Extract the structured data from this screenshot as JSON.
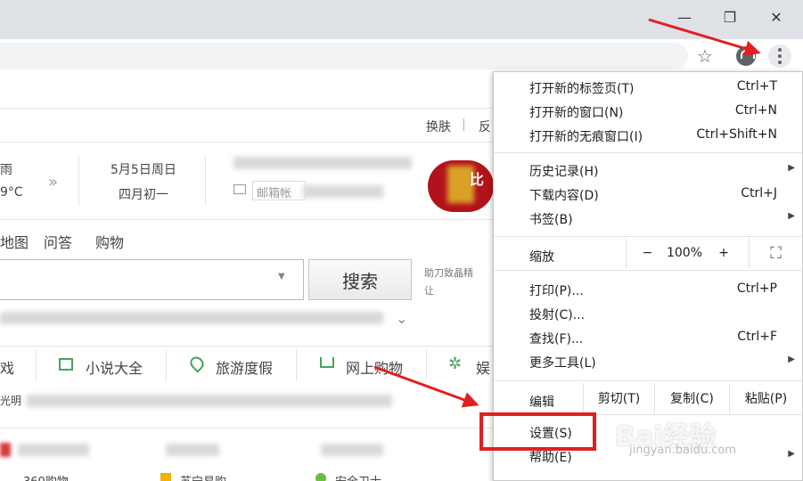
{
  "window_controls": {
    "minimize": "—",
    "restore": "❐",
    "close": "✕"
  },
  "toolbar": {
    "star_icon": "☆"
  },
  "page": {
    "header_links": [
      "换肤",
      "|",
      "反"
    ],
    "weather": {
      "condition": "雨",
      "temp": "9°C",
      "chevron": "»"
    },
    "date": {
      "solar": "5月5日周日",
      "lunar": "四月初一"
    },
    "mail": {
      "placeholder": "邮箱帐"
    },
    "nav_links": [
      "地图",
      "问答",
      "购物"
    ],
    "search": {
      "button": "搜索",
      "dropdown": "▼"
    },
    "ad_lines": [
      "助刀致晶精",
      "让"
    ],
    "categories": [
      {
        "icon": "book-icon",
        "label": "小说大全"
      },
      {
        "icon": "travel-icon",
        "label": "旅游度假"
      },
      {
        "icon": "cart-icon",
        "label": "网上购物"
      },
      {
        "icon": "star-icon",
        "label": "娱"
      }
    ],
    "category_prefix": "戏",
    "news_prefix": "光明",
    "bottom_links": [
      "360购物",
      "苏宁易购",
      "安全卫士"
    ],
    "expand_chevron": "⌄",
    "promo_text": "比"
  },
  "menu": {
    "group1": [
      {
        "label": "打开新的标签页(T)",
        "shortcut": "Ctrl+T"
      },
      {
        "label": "打开新的窗口(N)",
        "shortcut": "Ctrl+N"
      },
      {
        "label": "打开新的无痕窗口(I)",
        "shortcut": "Ctrl+Shift+N"
      }
    ],
    "group2": [
      {
        "label": "历史记录(H)",
        "shortcut": "",
        "arrow": "▶"
      },
      {
        "label": "下载内容(D)",
        "shortcut": "Ctrl+J",
        "arrow": ""
      },
      {
        "label": "书签(B)",
        "shortcut": "",
        "arrow": "▶"
      }
    ],
    "zoom": {
      "label": "缩放",
      "minus": "−",
      "value": "100%",
      "plus": "+",
      "fullscreen": "⛶"
    },
    "group3": [
      {
        "label": "打印(P)...",
        "shortcut": "Ctrl+P",
        "arrow": ""
      },
      {
        "label": "投射(C)...",
        "shortcut": "",
        "arrow": ""
      },
      {
        "label": "查找(F)...",
        "shortcut": "Ctrl+F",
        "arrow": ""
      },
      {
        "label": "更多工具(L)",
        "shortcut": "",
        "arrow": "▶"
      }
    ],
    "edit": {
      "label": "编辑",
      "cut": "剪切(T)",
      "copy": "复制(C)",
      "paste": "粘贴(P)"
    },
    "group4": [
      {
        "label": "设置(S)",
        "shortcut": "",
        "arrow": ""
      },
      {
        "label": "帮助(E)",
        "shortcut": "",
        "arrow": "▶"
      }
    ]
  },
  "watermark": {
    "main": "Bai经验",
    "sub": "jingyan.baidu.com"
  },
  "colors": {
    "annotation_red": "#e02020",
    "menu_bg": "#ffffff",
    "titlebar": "#dee1e6"
  }
}
